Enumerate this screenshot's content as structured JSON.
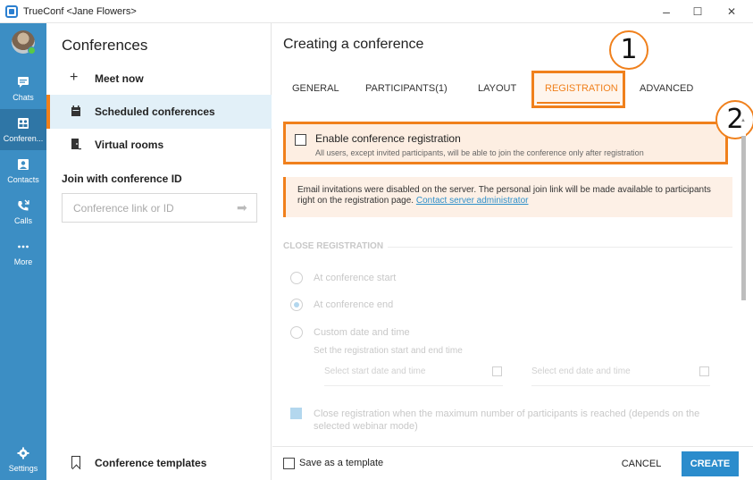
{
  "window": {
    "title": "TrueConf <Jane Flowers>",
    "minimize": "–",
    "maximize": "☐",
    "close": "✕"
  },
  "rail": {
    "items": [
      {
        "label": "Chats",
        "icon": "chat-icon"
      },
      {
        "label": "Conferen...",
        "icon": "conference-icon"
      },
      {
        "label": "Contacts",
        "icon": "contacts-icon"
      },
      {
        "label": "Calls",
        "icon": "calls-icon"
      },
      {
        "label": "More",
        "icon": "more-icon"
      },
      {
        "label": "Settings",
        "icon": "gear-icon"
      }
    ]
  },
  "conferences_panel": {
    "title": "Conferences",
    "items": [
      {
        "label": "Meet now",
        "icon": "plus-icon"
      },
      {
        "label": "Scheduled conferences",
        "icon": "calendar-icon"
      },
      {
        "label": "Virtual rooms",
        "icon": "door-icon"
      }
    ],
    "join_label": "Join with conference ID",
    "join_placeholder": "Conference link or ID",
    "templates_label": "Conference templates"
  },
  "create": {
    "title": "Creating a conference",
    "tabs": [
      "GENERAL",
      "PARTICIPANTS(1)",
      "LAYOUT",
      "REGISTRATION",
      "ADVANCED"
    ],
    "active_tab": "REGISTRATION",
    "callouts": [
      "1",
      "2"
    ],
    "registration": {
      "checkbox_label": "Enable conference registration",
      "checkbox_hint": "All users, except invited participants, will be able to join the conference only after registration"
    },
    "notice": {
      "text": "Email invitations were disabled on the server. The personal join link will be made available to participants right on the registration page. ",
      "link": "Contact server administrator"
    },
    "close_registration": {
      "section_title": "CLOSE REGISTRATION",
      "options": [
        "At conference start",
        "At conference end",
        "Custom date and time"
      ],
      "selected": "At conference end",
      "range_hint": "Set the registration start and end time",
      "start_placeholder": "Select start date and time",
      "end_placeholder": "Select end date and time",
      "max_participants_label": "Close registration when the maximum number of participants is reached (depends on the selected webinar mode)"
    },
    "footer": {
      "save_template": "Save as a template",
      "cancel": "CANCEL",
      "create": "CREATE"
    }
  },
  "colors": {
    "accent": "#f0801c",
    "rail": "#3c8ec4",
    "primary_button": "#2b8ccc",
    "link": "#2d8fc9"
  }
}
